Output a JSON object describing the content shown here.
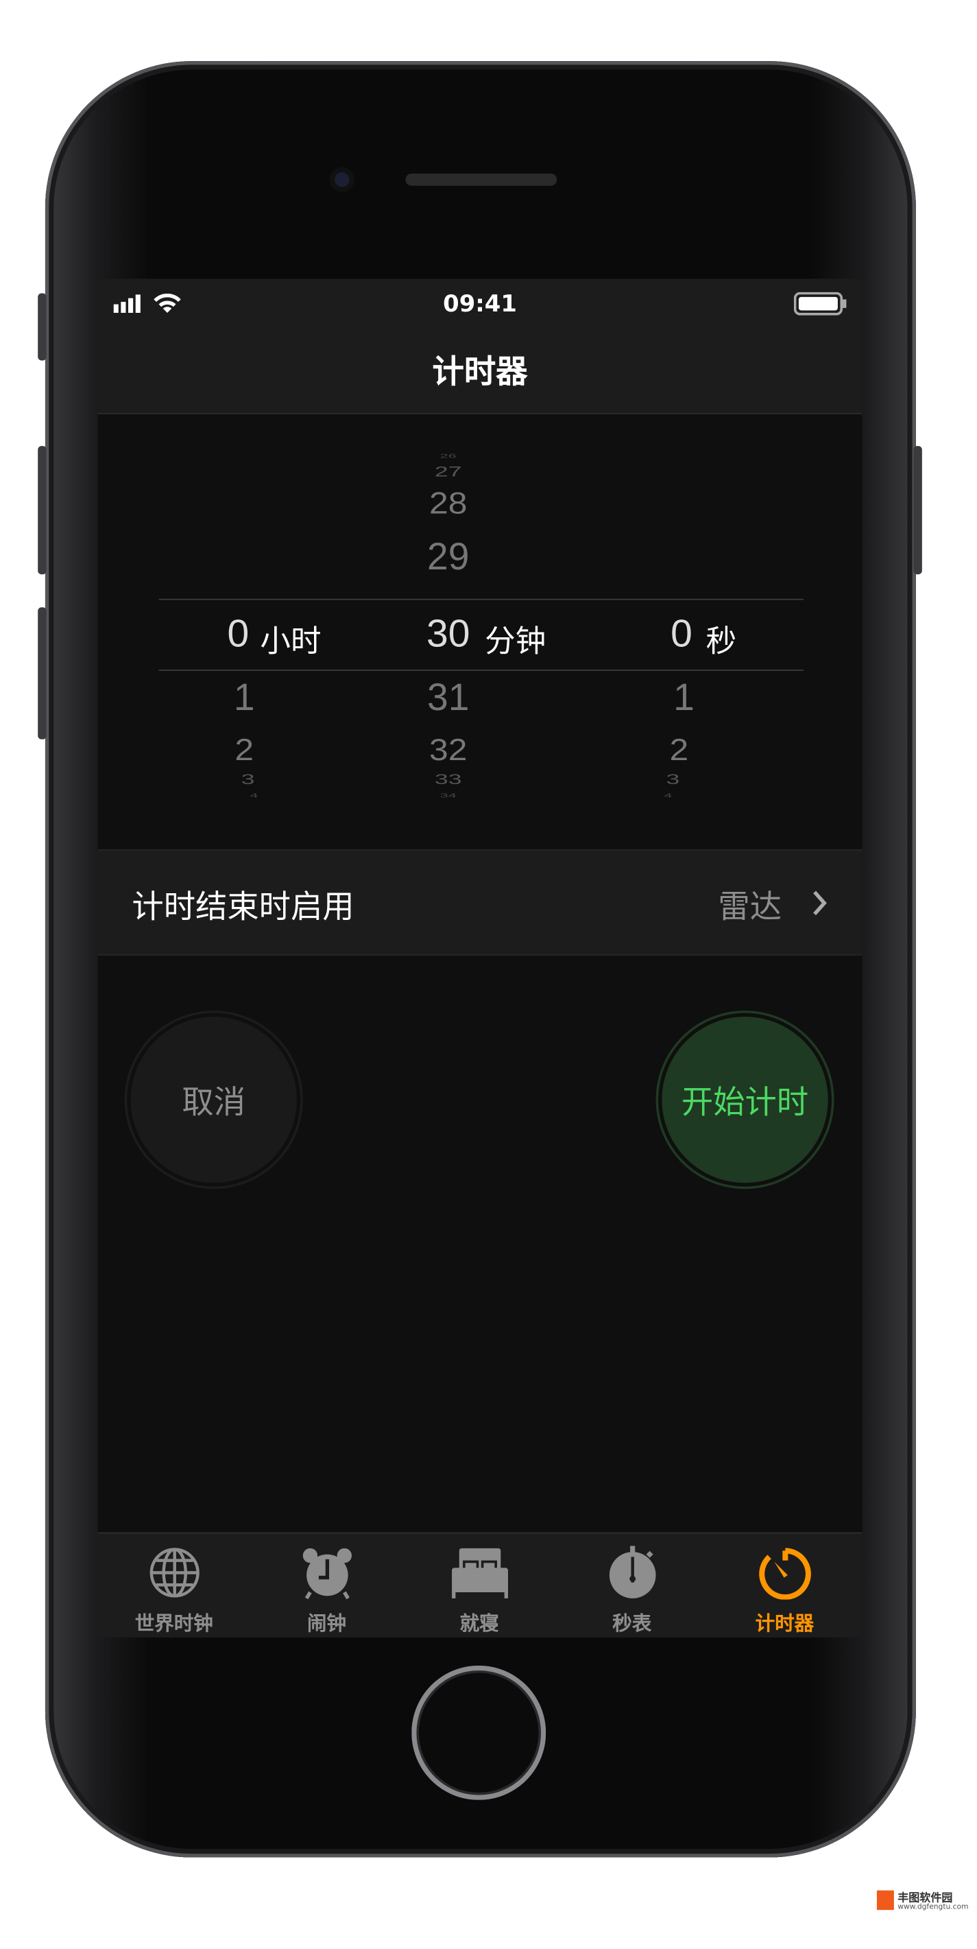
{
  "status_bar": {
    "time": "09:41"
  },
  "nav": {
    "title": "计时器"
  },
  "picker": {
    "hours": {
      "above": [],
      "selected": "0",
      "unit": "小时",
      "below": [
        "1",
        "2",
        "3",
        "4"
      ]
    },
    "minutes": {
      "above": [
        "26",
        "27",
        "28",
        "29"
      ],
      "selected": "30",
      "unit": "分钟",
      "below": [
        "31",
        "32",
        "33",
        "34"
      ]
    },
    "seconds": {
      "above": [],
      "selected": "0",
      "unit": "秒",
      "below": [
        "1",
        "2",
        "3",
        "4"
      ]
    }
  },
  "when_ends": {
    "label": "计时结束时启用",
    "value": "雷达"
  },
  "buttons": {
    "cancel": "取消",
    "start": "开始计时"
  },
  "tabs": [
    {
      "label": "世界时钟",
      "icon": "globe-icon"
    },
    {
      "label": "闹钟",
      "icon": "alarm-clock-icon"
    },
    {
      "label": "就寝",
      "icon": "bed-icon"
    },
    {
      "label": "秒表",
      "icon": "stopwatch-icon"
    },
    {
      "label": "计时器",
      "icon": "timer-icon",
      "active": true
    }
  ],
  "colors": {
    "accent": "#ff9500",
    "start_green": "#4cd964",
    "start_bg": "#1f3a22"
  },
  "watermark": {
    "name": "丰图软件园",
    "url": "www.dgfengtu.com"
  }
}
